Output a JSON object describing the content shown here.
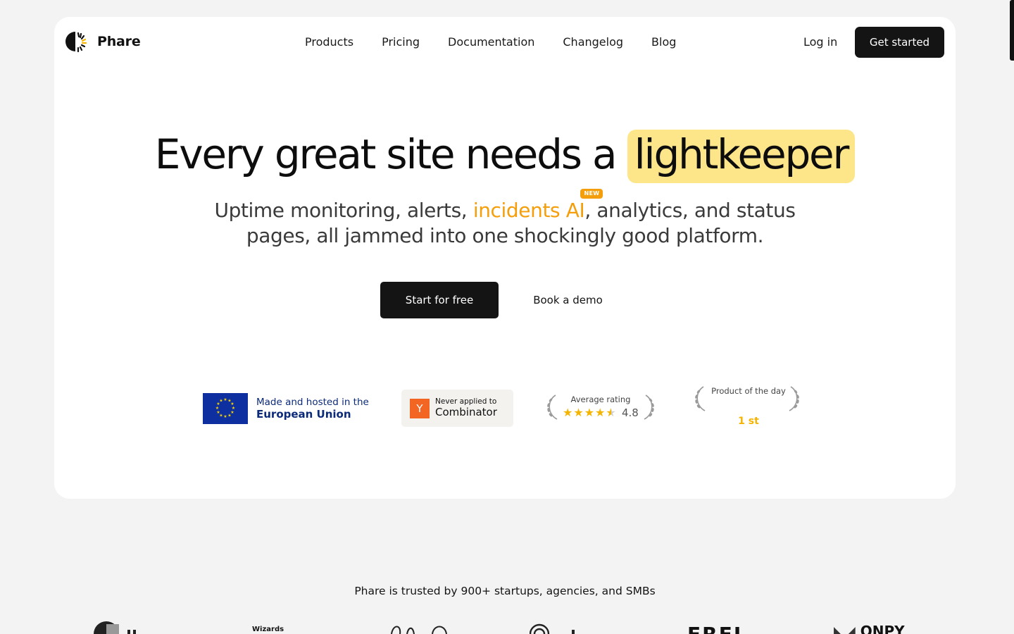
{
  "brand": {
    "name": "Phare"
  },
  "nav": {
    "links": [
      "Products",
      "Pricing",
      "Documentation",
      "Changelog",
      "Blog"
    ],
    "login": "Log in",
    "cta": "Get started"
  },
  "hero": {
    "title_main": "Every great site needs a ",
    "title_highlight": "lightkeeper",
    "subtitle_part1": "Uptime monitoring, alerts, ",
    "subtitle_accent": "incidents AI",
    "new_badge": "NEW",
    "subtitle_part2": ", analytics, and status pages, all jammed into one shockingly good platform.",
    "primary_cta": "Start for free",
    "secondary_cta": "Book a demo"
  },
  "badges": {
    "eu": {
      "line1": "Made and hosted in the",
      "line2": "European Union"
    },
    "yc": {
      "letter": "Y",
      "line1": "Never applied to",
      "line2": "Combinator"
    },
    "rating": {
      "label": "Average rating",
      "stars": 4.5,
      "value": "4.8"
    },
    "potd": {
      "label": "Product of the day",
      "rank": "1 st"
    }
  },
  "trusted": {
    "text": "Phare is trusted by 900+ startups, agencies, and SMBs"
  },
  "client_logos": [
    "Wizards",
    "EREI",
    "ONPY"
  ],
  "colors": {
    "accent": "#f59e0b",
    "highlight": "#fde68a",
    "dark": "#141414",
    "eu_blue": "#0b2a7a"
  }
}
